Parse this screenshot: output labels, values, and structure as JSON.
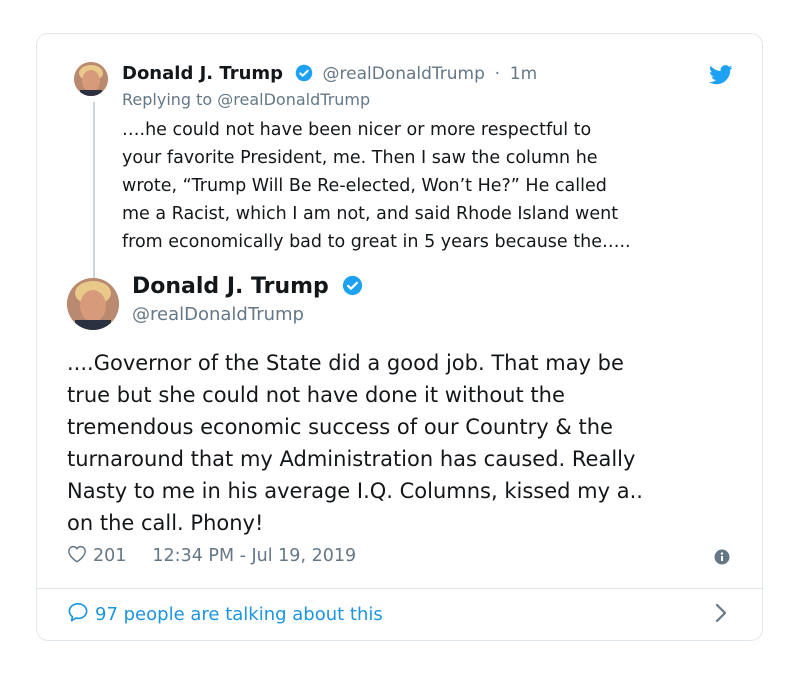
{
  "parent_tweet": {
    "name": "Donald J. Trump",
    "handle": "@realDonaldTrump",
    "separator": "·",
    "time": "1m",
    "replying_to": "Replying to @realDonaldTrump",
    "lines": [
      "….he could not have been nicer or more respectful to",
      "your favorite President, me. Then I saw the column he",
      "wrote, “Trump Will Be Re-elected, Won’t He?” He called",
      "me a Racist, which I am not, and said Rhode Island went",
      "from economically bad to great in 5 years because the….."
    ]
  },
  "main_tweet": {
    "name": "Donald J. Trump",
    "handle": "@realDonaldTrump",
    "lines": [
      "....Governor of the State did a good  job. That may be",
      "true but she could not have done it without the",
      "tremendous economic success of our Country & the",
      "turnaround that my Administration has caused. Really",
      "Nasty to me in his average I.Q. Columns, kissed my a..",
      "on the call. Phony!"
    ],
    "likes": "201",
    "timestamp": "12:34 PM - Jul 19, 2019"
  },
  "footer": {
    "talking": "97 people are talking about this"
  },
  "icons": {
    "verified": "verified-badge-icon",
    "bird": "twitter-bird-icon",
    "heart": "heart-icon",
    "info": "info-icon",
    "reply": "speech-bubble-icon",
    "chevron": "chevron-right-icon"
  },
  "colors": {
    "accent": "#1b95e0",
    "text": "#14171a",
    "muted": "#657786",
    "border": "#e1e8ed"
  }
}
